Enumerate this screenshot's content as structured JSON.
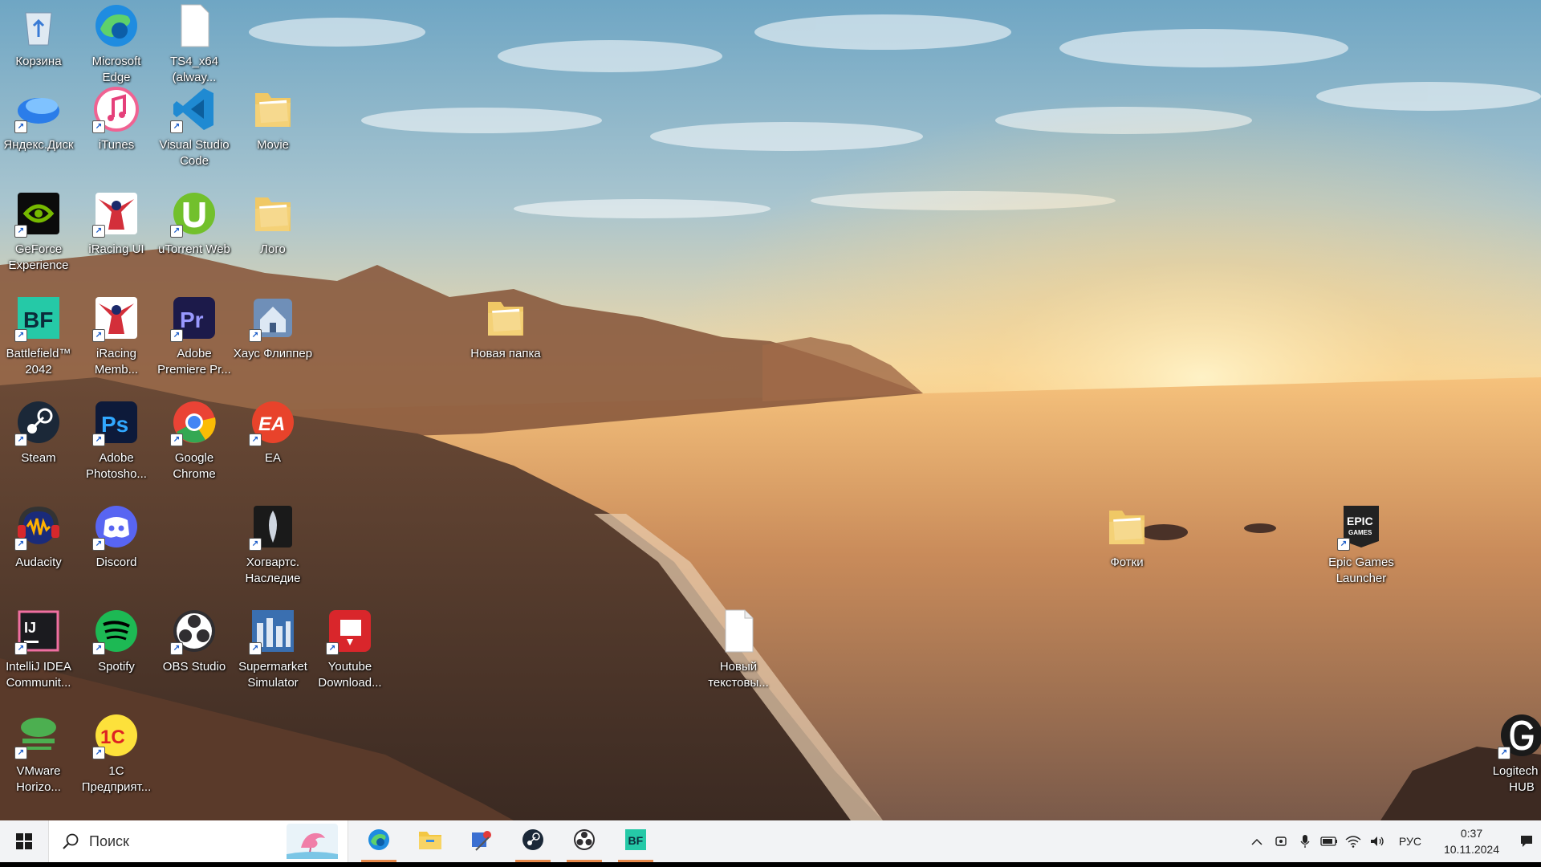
{
  "desktop": {
    "icons": [
      {
        "label": "Корзина",
        "icon": "recycle-bin-icon",
        "color": "#9ec3e6"
      },
      {
        "label": "Microsoft Edge",
        "icon": "edge-icon",
        "color": "#1f8ce0"
      },
      {
        "label": "TS4_x64 (alway...",
        "icon": "file-icon",
        "color": "#ffffff"
      },
      {
        "label": "Яндекс.Диск",
        "icon": "yandex-disk-icon",
        "color": "#2b7de9"
      },
      {
        "label": "iTunes",
        "icon": "itunes-icon",
        "color": "#f06292"
      },
      {
        "label": "Visual Studio Code",
        "icon": "vscode-icon",
        "color": "#1f8ad2"
      },
      {
        "label": "Movie",
        "icon": "folder-icon",
        "color": "#f0c865"
      },
      {
        "label": "GeForce Experience",
        "icon": "geforce-icon",
        "color": "#76b900"
      },
      {
        "label": "iRacing UI",
        "icon": "iracing-icon",
        "color": "#d32f3a"
      },
      {
        "label": "uTorrent Web",
        "icon": "utorrent-icon",
        "color": "#72c02c"
      },
      {
        "label": "Лого",
        "icon": "folder-icon",
        "color": "#f0c865"
      },
      {
        "label": "Battlefield™ 2042",
        "icon": "battlefield-icon",
        "color": "#25c9a7"
      },
      {
        "label": "iRacing Memb...",
        "icon": "iracing-icon",
        "color": "#d32f3a"
      },
      {
        "label": "Adobe Premiere Pr...",
        "icon": "premiere-icon",
        "color": "#1c1a4a"
      },
      {
        "label": "Хаус Флиппер",
        "icon": "house-flipper-icon",
        "color": "#6f8fb8"
      },
      {
        "label": "Новая папка",
        "icon": "folder-icon",
        "color": "#f0c865"
      },
      {
        "label": "Steam",
        "icon": "steam-icon",
        "color": "#1b2838"
      },
      {
        "label": "Adobe Photosho...",
        "icon": "photoshop-icon",
        "color": "#0d1a3a"
      },
      {
        "label": "Google Chrome",
        "icon": "chrome-icon",
        "color": "#ea4335"
      },
      {
        "label": "EA",
        "icon": "ea-icon",
        "color": "#e8432b"
      },
      {
        "label": "Audacity",
        "icon": "audacity-icon",
        "color": "#1a2b7a"
      },
      {
        "label": "Discord",
        "icon": "discord-icon",
        "color": "#5865f2"
      },
      {
        "label": "Хогвартс. Наследие",
        "icon": "hogwarts-legacy-icon",
        "color": "#2a2a2a"
      },
      {
        "label": "Фотки",
        "icon": "folder-icon",
        "color": "#f0c865"
      },
      {
        "label": "Epic Games Launcher",
        "icon": "epic-games-icon",
        "color": "#222222"
      },
      {
        "label": "IntelliJ IDEA Communit...",
        "icon": "intellij-icon",
        "color": "#1b1b1f"
      },
      {
        "label": "Spotify",
        "icon": "spotify-icon",
        "color": "#1db954"
      },
      {
        "label": "OBS Studio",
        "icon": "obs-icon",
        "color": "#302e31"
      },
      {
        "label": "Supermarket Simulator",
        "icon": "supermarket-simulator-icon",
        "color": "#3a6fb0"
      },
      {
        "label": "Youtube Download...",
        "icon": "youtube-downloader-icon",
        "color": "#d9262b"
      },
      {
        "label": "Новый текстовы...",
        "icon": "text-document-icon",
        "color": "#ffffff"
      },
      {
        "label": "VMware Horizo...",
        "icon": "vmware-horizon-icon",
        "color": "#4caf50"
      },
      {
        "label": "1С Предприят...",
        "icon": "1c-icon",
        "color": "#fde13b"
      },
      {
        "label": "Logitech G HUB",
        "icon": "logitech-g-hub-icon",
        "color": "#1a1a1a"
      }
    ]
  },
  "taskbar": {
    "search_placeholder": "Поиск",
    "apps": [
      {
        "icon": "edge-icon",
        "running": true
      },
      {
        "icon": "file-explorer-icon",
        "running": false
      },
      {
        "icon": "snipping-tool-icon",
        "running": false
      },
      {
        "icon": "steam-icon",
        "running": true
      },
      {
        "icon": "obs-icon",
        "running": true
      },
      {
        "icon": "battlefield-icon",
        "running": true
      }
    ],
    "tray": {
      "language": "РУС",
      "time": "0:37",
      "date": "10.11.2024"
    }
  },
  "colors": {
    "taskbar_bg": "#f2f3f5",
    "running_indicator": "#e8894a"
  }
}
